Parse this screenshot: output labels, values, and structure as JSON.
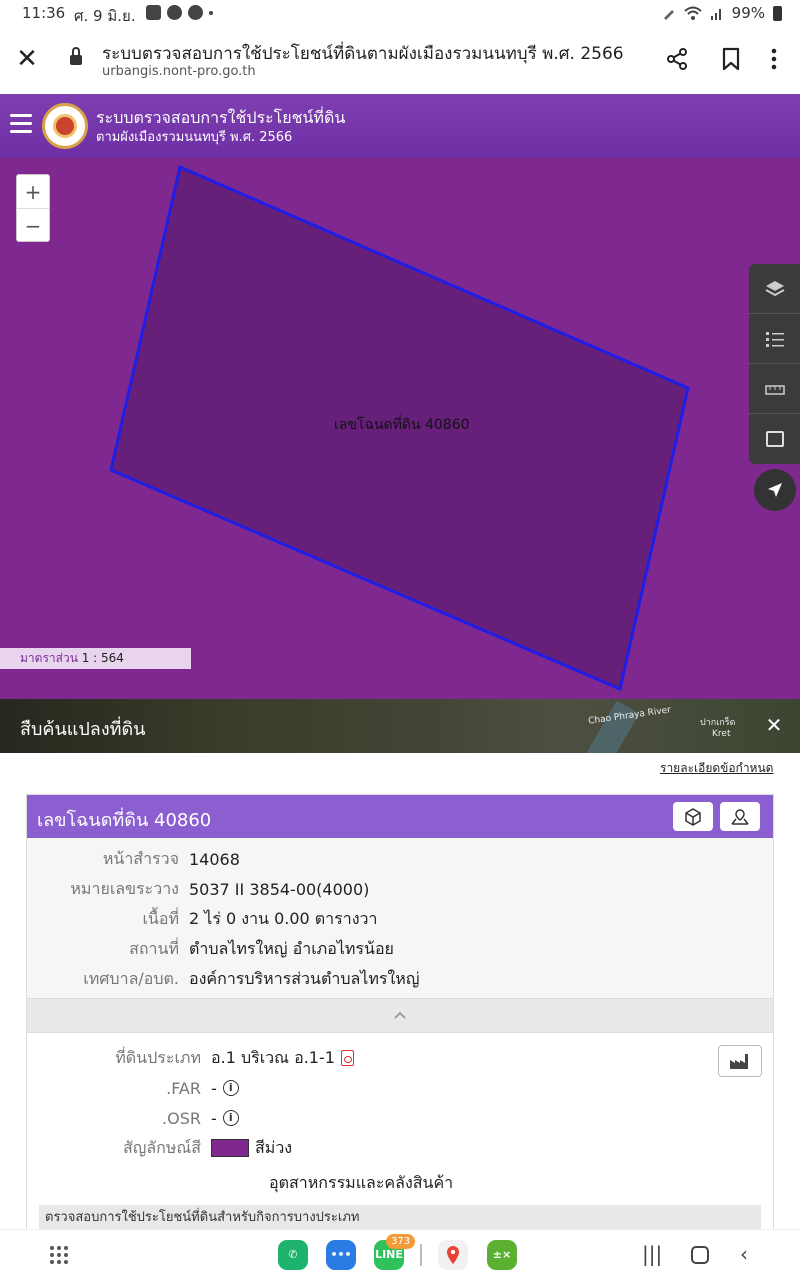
{
  "status_bar": {
    "time": "11:36",
    "date": "ศ. 9 มิ.ย.",
    "battery": "99%"
  },
  "browser": {
    "title": "ระบบตรวจสอบการใช้ประโยชน์ที่ดินตามผังเมืองรวมนนทบุรี พ.ศ. 2566",
    "url": "urbangis.nont-pro.go.th"
  },
  "app_header": {
    "title_line1": "ระบบตรวจสอบการใช้ประโยชน์ที่ดิน",
    "title_line2": "ตามผังเมืองรวมนนทบุรี พ.ศ. 2566"
  },
  "map": {
    "zoom_in": "+",
    "zoom_out": "−",
    "parcel_label": "เลขโฉนดที่ดิน 40860",
    "scale_label": "มาตราส่วน",
    "scale_value": "1 : 564",
    "land_use_color": "#7f2890",
    "parcel_fill": "#66207a",
    "parcel_stroke": "#1e1ee6"
  },
  "search_strip": {
    "title": "สืบค้นแปลงที่ดิน",
    "map_label_1": "Chao Phraya River",
    "map_label_2": "ปากเกร็ด",
    "map_label_3": "Kret"
  },
  "terms_link": "รายละเอียดข้อกำหนด",
  "parcel_card": {
    "title": "เลขโฉนดที่ดิน 40860",
    "rows": [
      {
        "label": "หน้าสำรวจ",
        "value": "14068"
      },
      {
        "label": "หมายเลขระวาง",
        "value": "5037 II 3854-00(4000)"
      },
      {
        "label": "เนื้อที่",
        "value": "2 ไร่ 0 งาน 0.00 ตารางวา"
      },
      {
        "label": "สถานที่",
        "value": "ตำบลไทรใหญ่ อำเภอไทรน้อย"
      },
      {
        "label": "เทศบาล/อบต.",
        "value": "องค์การบริหารส่วนตำบลไทรใหญ่"
      }
    ],
    "collapse_icon": "chevron-up",
    "land_type_label": "ที่ดินประเภท",
    "land_type_value": "อ.1 บริเวณ อ.1-1",
    "far_label": ".FAR",
    "far_value": "-",
    "osr_label": ".OSR",
    "osr_value": "-",
    "color_label": "สัญลักษณ์สี",
    "color_name": "สีม่วง",
    "color_desc": "อุตสาหกรรมและคลังสินค้า",
    "check_title": "ตรวจสอบการใช้ประโยชน์ที่ดินสำหรับกิจการบางประเภท"
  },
  "nav_bar": {
    "line_badge": "373",
    "apps": [
      "phone-app",
      "messages-app",
      "line-app",
      "maps-app",
      "calculator-app"
    ]
  }
}
